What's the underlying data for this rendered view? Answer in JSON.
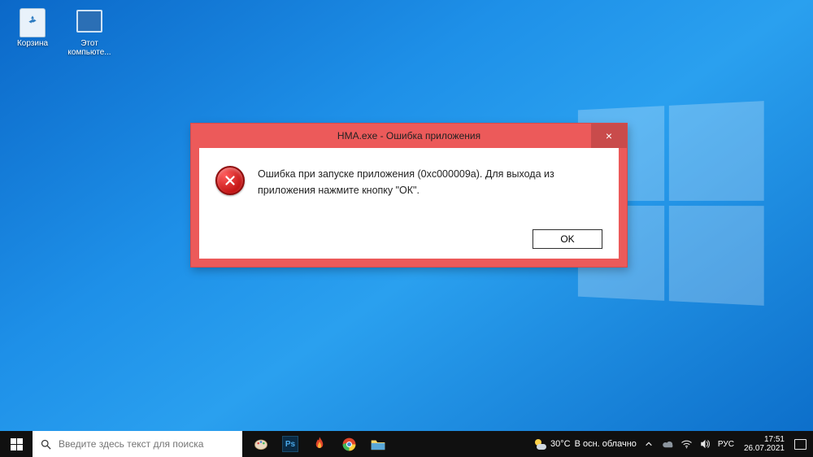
{
  "desktop": {
    "icons": [
      {
        "name": "recycle-bin",
        "label": "Корзина"
      },
      {
        "name": "this-pc",
        "label": "Этот компьюте..."
      }
    ]
  },
  "dialog": {
    "title": "HMA.exe - Ошибка приложения",
    "message": "Ошибка при запуске приложения (0xc000009a). Для выхода из приложения нажмите кнопку \"ОК\".",
    "ok_label": "OK",
    "close_label": "×"
  },
  "taskbar": {
    "search_placeholder": "Введите здесь текст для поиска",
    "apps": [
      {
        "name": "paint",
        "color": "#4a8bd8"
      },
      {
        "name": "photoshop",
        "label": "Ps",
        "bg": "#0a2a44",
        "fg": "#4aa8e8"
      },
      {
        "name": "ccleaner",
        "color": "#e0452a"
      },
      {
        "name": "chrome"
      },
      {
        "name": "file-explorer"
      }
    ],
    "weather": {
      "temp": "30°C",
      "desc": "В осн. облачно"
    },
    "lang": "РУС",
    "time": "17:51",
    "date": "26.07.2021"
  }
}
